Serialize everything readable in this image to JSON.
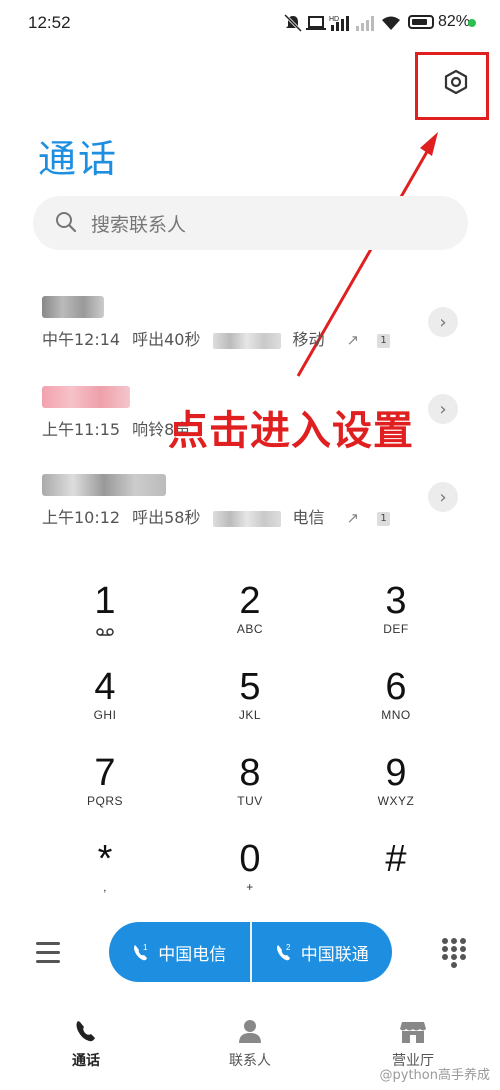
{
  "status_bar": {
    "time": "12:52",
    "icons": [
      "mute-bell-icon",
      "laptop-icon",
      "hd-signal-icon",
      "signal-bars-icon",
      "wifi-icon"
    ],
    "battery_percent": "82%",
    "battery_level": 0.82,
    "charging_indicator_color": "#2bbf4f"
  },
  "header": {
    "title": "通话",
    "settings_icon": "settings-hexagon-icon"
  },
  "search": {
    "placeholder": "搜索联系人"
  },
  "call_log": [
    {
      "name_hidden": true,
      "period": "中午12:14",
      "type_duration": "呼出40秒",
      "carrier": "移动",
      "direction": "outgoing",
      "sim": "1"
    },
    {
      "name_hidden": true,
      "period": "上午11:15",
      "type_duration": "响铃8声",
      "carrier": "",
      "direction": "incoming",
      "sim": ""
    },
    {
      "name_hidden": true,
      "period": "上午10:12",
      "type_duration": "呼出58秒",
      "carrier": "电信",
      "direction": "outgoing",
      "sim": "1"
    }
  ],
  "annotation": {
    "text": "点击进入设置",
    "color": "#e02020"
  },
  "keypad": [
    {
      "digit": "1",
      "letters": ""
    },
    {
      "digit": "2",
      "letters": "ABC"
    },
    {
      "digit": "3",
      "letters": "DEF"
    },
    {
      "digit": "4",
      "letters": "GHI"
    },
    {
      "digit": "5",
      "letters": "JKL"
    },
    {
      "digit": "6",
      "letters": "MNO"
    },
    {
      "digit": "7",
      "letters": "PQRS"
    },
    {
      "digit": "8",
      "letters": "TUV"
    },
    {
      "digit": "9",
      "letters": "WXYZ"
    },
    {
      "digit": "*",
      "letters": ","
    },
    {
      "digit": "0",
      "letters": "+"
    },
    {
      "digit": "#",
      "letters": ""
    }
  ],
  "call_buttons": {
    "sim1": {
      "label": "中国电信",
      "badge": "1"
    },
    "sim2": {
      "label": "中国联通",
      "badge": "2"
    },
    "color": "#1e8fe0"
  },
  "bottom_nav": [
    {
      "label": "通话",
      "icon": "phone-icon",
      "active": true
    },
    {
      "label": "联系人",
      "icon": "person-icon",
      "active": false
    },
    {
      "label": "营业厅",
      "icon": "store-icon",
      "active": false
    }
  ],
  "watermark": "@python高手养成",
  "accent_color": "#1e8fe0"
}
